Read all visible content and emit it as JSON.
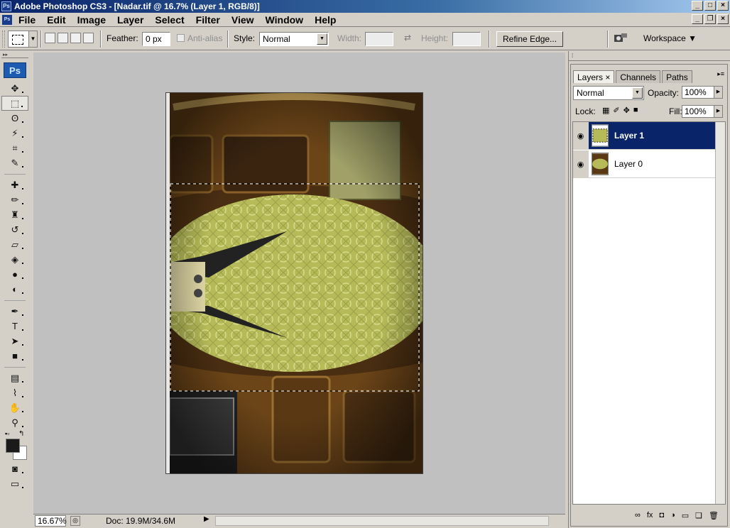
{
  "window": {
    "title": "Adobe Photoshop CS3 - [Nadar.tif @ 16.7% (Layer 1, RGB/8)]",
    "app_icon": "Ps",
    "controls": [
      "_",
      "□",
      "×"
    ]
  },
  "menu": {
    "items": [
      "File",
      "Edit",
      "Image",
      "Layer",
      "Select",
      "Filter",
      "View",
      "Window",
      "Help"
    ],
    "doc_controls": [
      "_",
      "❐",
      "×"
    ]
  },
  "options": {
    "feather_label": "Feather:",
    "feather_value": "0 px",
    "antialias_label": "Anti-alias",
    "style_label": "Style:",
    "style_value": "Normal",
    "width_label": "Width:",
    "height_label": "Height:",
    "refine_edge": "Refine Edge...",
    "workspace": "Workspace ▼"
  },
  "toolbox": {
    "logo": "Ps",
    "tools": [
      "move-tool",
      "marquee-tool",
      "lasso-tool",
      "magic-wand-tool",
      "crop-tool",
      "slice-tool",
      "healing-brush-tool",
      "brush-tool",
      "clone-stamp-tool",
      "history-brush-tool",
      "eraser-tool",
      "paint-bucket-tool",
      "blur-tool",
      "dodge-tool",
      "pen-tool",
      "type-tool",
      "path-selection-tool",
      "rectangle-tool",
      "notes-tool",
      "eyedropper-tool",
      "hand-tool",
      "zoom-tool"
    ],
    "selected_tool": "marquee-tool",
    "colors": {
      "foreground": "#1a1a1a",
      "background": "#ffffff"
    }
  },
  "status": {
    "zoom": "16.67%",
    "doc": "Doc: 19.9M/34.6M"
  },
  "layers_panel": {
    "tabs": [
      "Layers ×",
      "Channels",
      "Paths"
    ],
    "active_tab": "Layers ×",
    "blend_mode": "Normal",
    "opacity_label": "Opacity:",
    "opacity": "100%",
    "lock_label": "Lock:",
    "fill_label": "Fill:",
    "fill": "100%",
    "layers": [
      {
        "name": "Layer 1",
        "visible": true,
        "selected": true
      },
      {
        "name": "Layer 0",
        "visible": true,
        "selected": false
      }
    ]
  },
  "colors": {
    "title_bar": "#0a246a",
    "selected_layer": "#0a246a",
    "workspace_bg": "#c0c0c0",
    "ui_gray": "#d4d0c8"
  }
}
